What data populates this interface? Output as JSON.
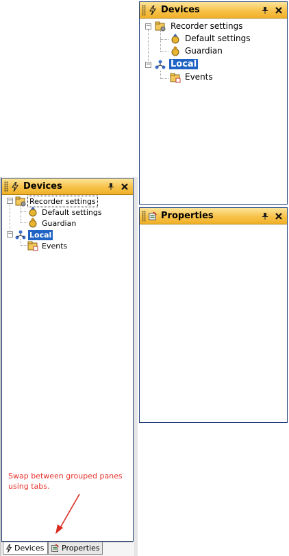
{
  "devices_pane": {
    "title": "Devices",
    "pin_icon": "pin-icon",
    "close_icon": "close-icon"
  },
  "properties_pane": {
    "title": "Properties"
  },
  "tree": {
    "recorder_settings": "Recorder settings",
    "default_settings": "Default settings",
    "guardian": "Guardian",
    "local": "Local",
    "events": "Events"
  },
  "tabs": [
    {
      "label": "Devices",
      "active": true
    },
    {
      "label": "Properties",
      "active": false
    }
  ],
  "annotation": "Swap between grouped panes using tabs.",
  "colors": {
    "header": "#f7c24a",
    "border": "#1f3f7a",
    "selection": "#1f63c4",
    "annotation": "#e8312a"
  }
}
